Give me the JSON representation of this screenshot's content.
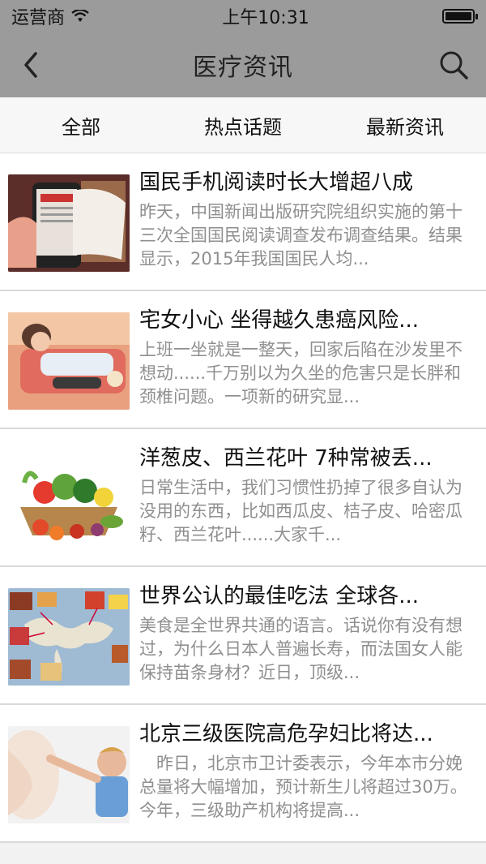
{
  "status": {
    "carrier": "运营商",
    "time": "上午10:31"
  },
  "header": {
    "title": "医疗资讯"
  },
  "tabs": [
    {
      "label": "全部"
    },
    {
      "label": "热点话题"
    },
    {
      "label": "最新资讯"
    }
  ],
  "news": [
    {
      "title": "国民手机阅读时长大增超八成",
      "summary": "昨天，中国新闻出版研究院组织实施的第十三次全国国民阅读调查发布调查结果。结果显示，2015年我国国民人均..."
    },
    {
      "title": "宅女小心 坐得越久患癌风险...",
      "summary": "上班一坐就是一整天，回家后陷在沙发里不想动......千万别以为久坐的危害只是长胖和颈椎问题。一项新的研究显..."
    },
    {
      "title": "洋葱皮、西兰花叶 7种常被丢...",
      "summary": "日常生活中，我们习惯性扔掉了很多自认为没用的东西，比如西瓜皮、桔子皮、哈密瓜籽、西兰花叶......大家千..."
    },
    {
      "title": "世界公认的最佳吃法 全球各...",
      "summary": "美食是全世界共通的语言。话说你有没有想过，为什么日本人普遍长寿，而法国女人能保持苗条身材？近日，顶级..."
    },
    {
      "title": "北京三级医院高危孕妇比将达...",
      "summary": "　昨日，北京市卫计委表示，今年本市分娩总量将大幅增加，预计新生儿将超过30万。今年，三级助产机构将提高..."
    }
  ],
  "icons": {
    "back": "chevron-left-icon",
    "search": "search-icon",
    "wifi": "wifi-icon",
    "battery": "battery-icon"
  },
  "colors": {
    "header_bg": "#9b9b9b",
    "tab_bg": "#f7f7f7",
    "summary_text": "#8f8f8f"
  }
}
